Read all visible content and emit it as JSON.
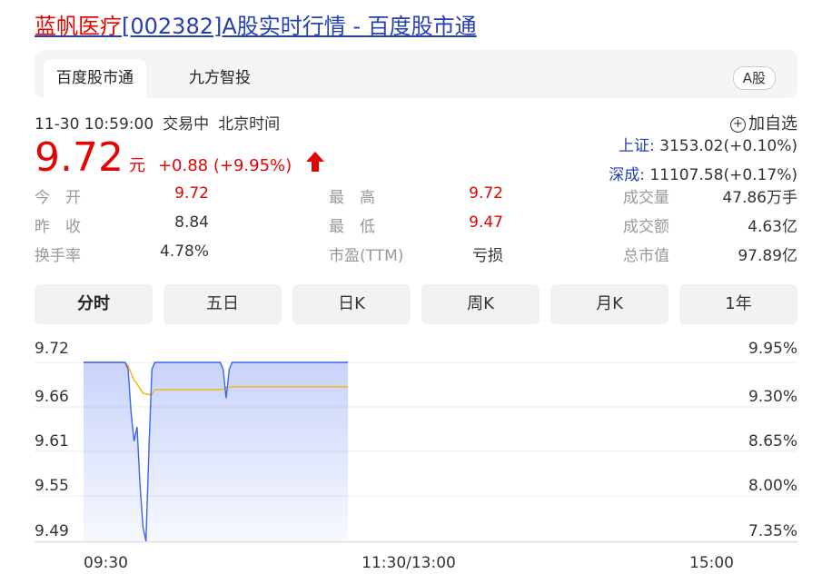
{
  "title": {
    "name": "蓝帆医疗",
    "rest": "[002382]A股实时行情 - 百度股市通"
  },
  "source_tabs": [
    {
      "label": "百度股市通",
      "active": true
    },
    {
      "label": "九方智投",
      "active": false
    }
  ],
  "market_badge": "A股",
  "status": {
    "datetime": "11-30 10:59:00",
    "state": "交易中",
    "zone": "北京时间"
  },
  "add_watchlist": "加自选",
  "quote": {
    "price": "9.72",
    "unit": "元",
    "change": "+0.88 (+9.95%)",
    "direction": "up"
  },
  "indices": [
    {
      "label": "上证:",
      "value": "3153.02(+0.10%)"
    },
    {
      "label": "深成:",
      "value": "11107.58(+0.17%)"
    }
  ],
  "stats": [
    [
      {
        "label": "今　开",
        "value": "9.72",
        "color": "red"
      },
      {
        "label": "最　高",
        "value": "9.72",
        "color": "red"
      },
      {
        "label": "成交量",
        "value": "47.86万手",
        "color": "plain"
      }
    ],
    [
      {
        "label": "昨　收",
        "value": "8.84",
        "color": "plain"
      },
      {
        "label": "最　低",
        "value": "9.47",
        "color": "red"
      },
      {
        "label": "成交额",
        "value": "4.63亿",
        "color": "plain"
      }
    ],
    [
      {
        "label": "换手率",
        "value": "4.78%",
        "color": "plain"
      },
      {
        "label": "市盈(TTM)",
        "value": "亏损",
        "color": "plain"
      },
      {
        "label": "总市值",
        "value": "97.89亿",
        "color": "plain"
      }
    ]
  ],
  "period_tabs": [
    "分时",
    "五日",
    "日K",
    "周K",
    "月K",
    "1年"
  ],
  "active_period": "分时",
  "colors": {
    "up": "#e10601",
    "link": "#2440b3",
    "price_line": "#3d63f0",
    "avg_line": "#f5b400"
  },
  "chart_data": {
    "type": "line",
    "title": "",
    "ylim": [
      9.47,
      9.72
    ],
    "y_ticks_left": [
      "9.72",
      "9.66",
      "9.61",
      "9.55",
      "9.49"
    ],
    "y_ticks_right": [
      "9.95%",
      "9.30%",
      "8.65%",
      "8.00%",
      "7.35%"
    ],
    "x_ticks": [
      "09:30",
      "11:30/13:00",
      "15:00"
    ],
    "total_minutes": 240,
    "series": [
      {
        "values": [
          [
            0,
            9.72
          ],
          [
            14,
            9.72
          ],
          [
            15,
            9.71
          ],
          [
            16,
            9.65
          ],
          [
            17,
            9.61
          ],
          [
            18,
            9.63
          ],
          [
            19,
            9.55
          ],
          [
            20,
            9.49
          ],
          [
            21,
            9.47
          ],
          [
            22,
            9.6
          ],
          [
            23,
            9.71
          ],
          [
            24,
            9.72
          ],
          [
            30,
            9.72
          ],
          [
            46,
            9.72
          ],
          [
            47,
            9.71
          ],
          [
            48,
            9.67
          ],
          [
            49,
            9.71
          ],
          [
            50,
            9.72
          ],
          [
            89,
            9.72
          ]
        ]
      },
      {
        "values": [
          [
            0,
            9.72
          ],
          [
            14,
            9.72
          ],
          [
            15,
            9.715
          ],
          [
            16,
            9.705
          ],
          [
            17,
            9.695
          ],
          [
            18,
            9.69
          ],
          [
            20,
            9.677
          ],
          [
            22,
            9.675
          ],
          [
            23,
            9.675
          ],
          [
            24,
            9.682
          ],
          [
            30,
            9.682
          ],
          [
            46,
            9.682
          ],
          [
            47,
            9.682
          ],
          [
            48,
            9.685
          ],
          [
            50,
            9.686
          ],
          [
            89,
            9.686
          ]
        ]
      }
    ]
  }
}
